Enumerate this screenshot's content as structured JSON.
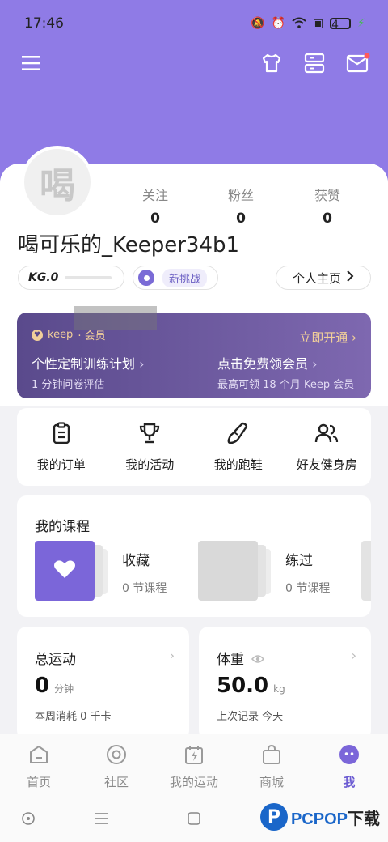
{
  "status_bar": {
    "time": "17:46",
    "battery": "4"
  },
  "profile": {
    "avatar_text": "喝",
    "username": "喝可乐的_Keeper34b1",
    "stats": [
      {
        "label": "关注",
        "value": "0"
      },
      {
        "label": "粉丝",
        "value": "0"
      },
      {
        "label": "获赞",
        "value": "0"
      }
    ],
    "kg_level": "KG.0",
    "challenge_label": "新挑战",
    "homepage_label": "个人主页"
  },
  "vip": {
    "brand": "keep",
    "brand_suffix": "· 会员",
    "open_label": "立即开通",
    "items": [
      {
        "title": "个性定制训练计划",
        "subtitle": "1 分钟问卷评估"
      },
      {
        "title": "点击免费领会员",
        "subtitle": "最高可领 18 个月 Keep 会员"
      }
    ]
  },
  "quick_actions": [
    {
      "label": "我的订单",
      "icon": "clipboard-icon"
    },
    {
      "label": "我的活动",
      "icon": "trophy-icon"
    },
    {
      "label": "我的跑鞋",
      "icon": "shoe-icon"
    },
    {
      "label": "好友健身房",
      "icon": "friends-icon"
    }
  ],
  "courses": {
    "title": "我的课程",
    "items": [
      {
        "name": "收藏",
        "count": "0 节课程"
      },
      {
        "name": "练过",
        "count": "0 节课程"
      }
    ]
  },
  "exercise": {
    "title": "总运动",
    "value": "0",
    "unit": "分钟",
    "subtitle": "本周消耗 0 千卡"
  },
  "weight": {
    "title": "体重",
    "value": "50.0",
    "unit": "kg",
    "subtitle": "上次记录 今天"
  },
  "tabs": [
    {
      "label": "首页",
      "icon": "home-icon"
    },
    {
      "label": "社区",
      "icon": "community-icon"
    },
    {
      "label": "我的运动",
      "icon": "calendar-bolt-icon"
    },
    {
      "label": "商城",
      "icon": "shop-bag-icon"
    },
    {
      "label": "我",
      "icon": "me-icon",
      "active": true
    }
  ],
  "watermark": {
    "logo": "P",
    "text_a": "PCPOP",
    "text_b": "下载"
  },
  "colors": {
    "brand": "#8f7be6",
    "accent": "#6b5bd2",
    "vip_gold": "#f1cf9a"
  }
}
